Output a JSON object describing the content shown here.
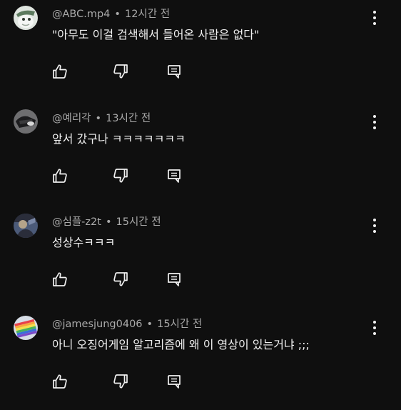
{
  "comments": [
    {
      "author": "@ABC.mp4",
      "separator": "•",
      "time": "12시간 전",
      "text": "\"아무도 이걸 검색해서 들어온 사람은 없다\"",
      "avatar_icon": "avatar-image-icon",
      "avatar_colors": [
        "#9aa79a",
        "#dfe5df",
        "#2f3a30"
      ]
    },
    {
      "author": "@예리각",
      "separator": "•",
      "time": "13시간 전",
      "text": "앞서 갔구나 ㅋㅋㅋㅋㅋㅋㅋ",
      "avatar_icon": "avatar-image-icon",
      "avatar_colors": [
        "#6e6e70",
        "#d8d8d8",
        "#1c1c1e"
      ]
    },
    {
      "author": "@심플-z2t",
      "separator": "•",
      "time": "15시간 전",
      "text": "성상수ㅋㅋㅋ",
      "avatar_icon": "avatar-image-icon",
      "avatar_colors": [
        "#4b5a78",
        "#b5a48a",
        "#2a2d3a"
      ]
    },
    {
      "author": "@jamesjung0406",
      "separator": "•",
      "time": "15시간 전",
      "text": "아니 오징어게임 알고리즘에 왜 이 영상이 있는거냐 ;;;",
      "avatar_icon": "rainbow-flag-icon",
      "avatar_colors": [
        "#e8404a",
        "#f7a83b",
        "#f3e04a",
        "#48b35a",
        "#3b6fd9",
        "#7a4bc9"
      ]
    }
  ],
  "icons": {
    "like": "thumbs-up-icon",
    "dislike": "thumbs-down-icon",
    "reply": "reply-icon",
    "more": "more-vertical-icon"
  },
  "colors": {
    "background": "#0f0f0f",
    "text": "#f1f1f1",
    "secondary": "#aaaaaa"
  }
}
